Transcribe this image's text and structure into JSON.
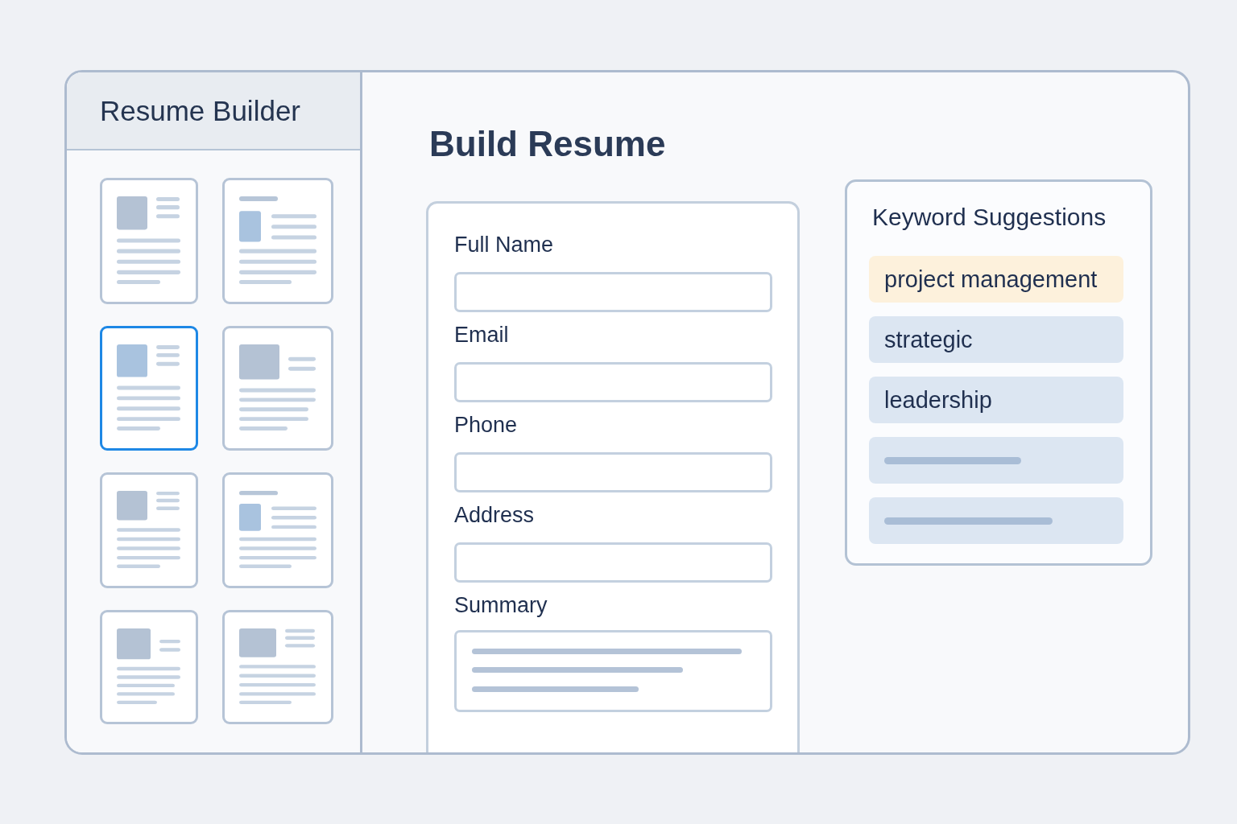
{
  "sidebar": {
    "title": "Resume Builder",
    "templates": [
      {
        "kind": "photo",
        "selected": false
      },
      {
        "kind": "banner",
        "selected": false
      },
      {
        "kind": "photo",
        "selected": true
      },
      {
        "kind": "photo-large",
        "selected": false
      },
      {
        "kind": "photo",
        "selected": false
      },
      {
        "kind": "banner",
        "selected": false
      },
      {
        "kind": "photo-large",
        "selected": false
      },
      {
        "kind": "photo",
        "selected": false
      }
    ]
  },
  "main": {
    "title": "Build Resume",
    "form": {
      "fields": [
        {
          "label": "Full Name",
          "kind": "input"
        },
        {
          "label": "Email",
          "kind": "input"
        },
        {
          "label": "Phone",
          "kind": "input"
        },
        {
          "label": "Address",
          "kind": "input"
        },
        {
          "label": "Summary",
          "kind": "textarea"
        }
      ]
    }
  },
  "keyword_panel": {
    "title": "Keyword Suggestions",
    "items": [
      {
        "kind": "keyword",
        "label": "project management",
        "selected": true
      },
      {
        "kind": "keyword",
        "label": "strategic",
        "selected": false
      },
      {
        "kind": "keyword",
        "label": "leadership",
        "selected": false
      },
      {
        "kind": "skeleton",
        "selected": false
      },
      {
        "kind": "skeleton",
        "selected": false
      }
    ]
  }
}
